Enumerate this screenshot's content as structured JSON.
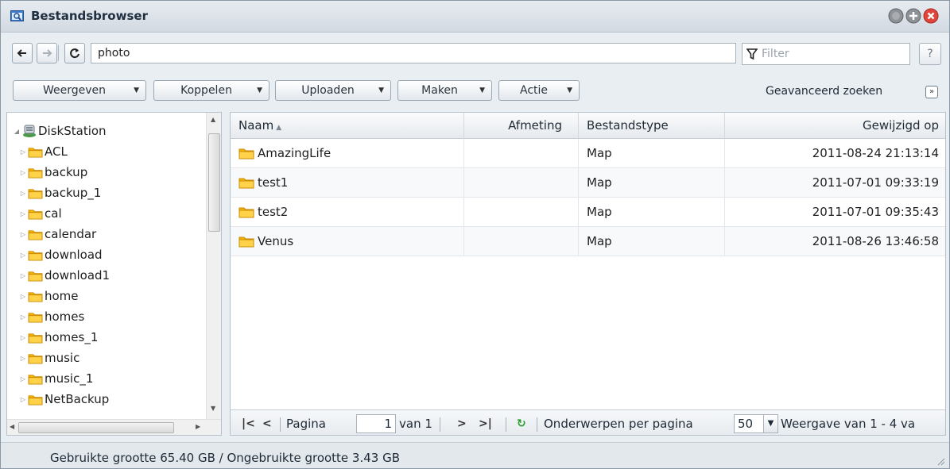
{
  "window": {
    "title": "Bestandsbrowser"
  },
  "addressbar": {
    "path": "photo",
    "filter_placeholder": "Filter",
    "help_label": "?"
  },
  "toolbar": {
    "buttons": [
      {
        "label": "Weergeven"
      },
      {
        "label": "Koppelen"
      },
      {
        "label": "Uploaden"
      },
      {
        "label": "Maken"
      },
      {
        "label": "Actie"
      }
    ],
    "advanced_search": "Geavanceerd zoeken"
  },
  "tree": {
    "root": "DiskStation",
    "items": [
      "ACL",
      "backup",
      "backup_1",
      "cal",
      "calendar",
      "download",
      "download1",
      "home",
      "homes",
      "homes_1",
      "music",
      "music_1",
      "NetBackup"
    ]
  },
  "grid": {
    "columns": {
      "name": "Naam",
      "size": "Afmeting",
      "type": "Bestandstype",
      "modified": "Gewijzigd op"
    },
    "rows": [
      {
        "name": "AmazingLife",
        "size": "",
        "type": "Map",
        "modified": "2011-08-24 21:13:14"
      },
      {
        "name": "test1",
        "size": "",
        "type": "Map",
        "modified": "2011-07-01 09:33:19"
      },
      {
        "name": "test2",
        "size": "",
        "type": "Map",
        "modified": "2011-07-01 09:35:43"
      },
      {
        "name": "Venus",
        "size": "",
        "type": "Map",
        "modified": "2011-08-26 13:46:58"
      }
    ]
  },
  "pager": {
    "page_label": "Pagina",
    "page_value": "1",
    "of_label": "van 1",
    "per_page_label": "Onderwerpen per pagina",
    "per_page_value": "50",
    "display_label": "Weergave van 1 - 4 va"
  },
  "status": {
    "text": "Gebruikte grootte 65.40 GB / Ongebruikte grootte 3.43 GB"
  },
  "colors": {
    "accent_close": "#e0443a",
    "folder": "#f4b400",
    "refresh_green": "#2a9a2a"
  }
}
